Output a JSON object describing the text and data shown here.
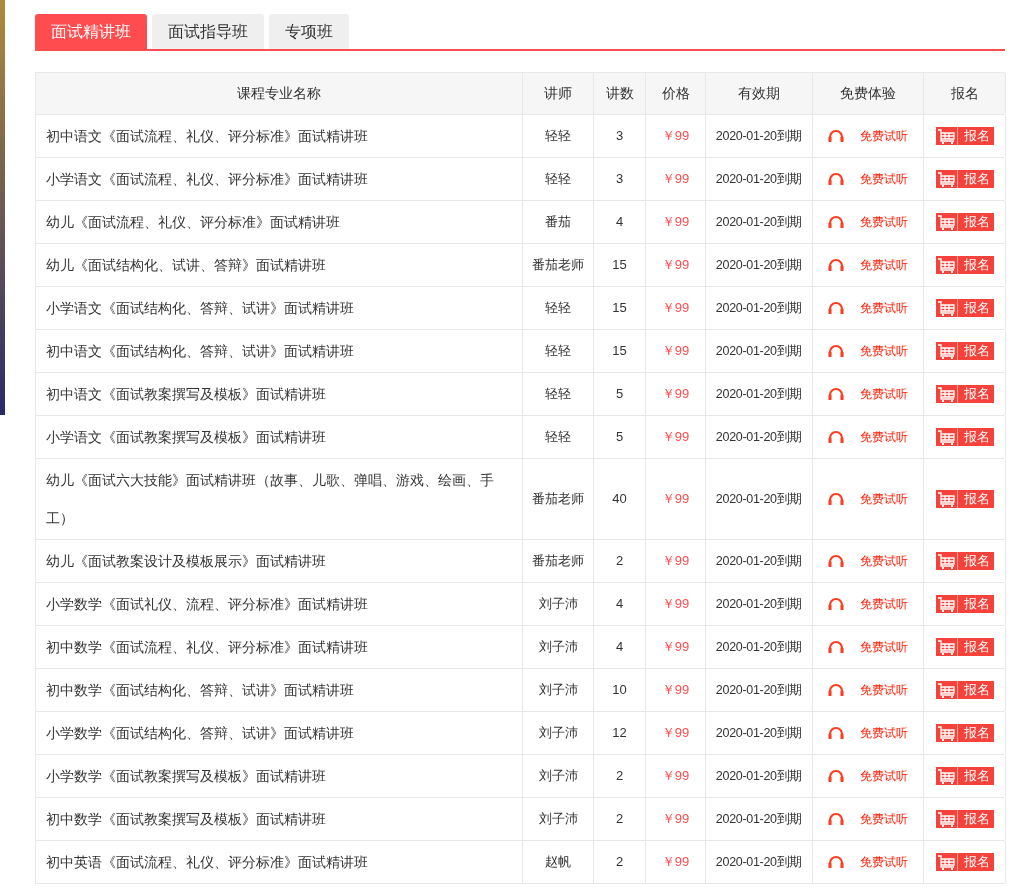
{
  "tabs": [
    {
      "label": "面试精讲班",
      "selected": true
    },
    {
      "label": "面试指导班",
      "selected": false
    },
    {
      "label": "专项班",
      "selected": false
    }
  ],
  "table": {
    "columns": [
      "课程专业名称",
      "讲师",
      "讲数",
      "价格",
      "有效期",
      "免费体验",
      "报名"
    ],
    "rows": [
      {
        "name": "初中语文《面试流程、礼仪、评分标准》面试精讲班",
        "teacher": "轻轻",
        "lessons": "3",
        "price": "￥99",
        "expiry": "2020-01-20到期",
        "trial": "免费试听",
        "signup": "报名"
      },
      {
        "name": "小学语文《面试流程、礼仪、评分标准》面试精讲班",
        "teacher": "轻轻",
        "lessons": "3",
        "price": "￥99",
        "expiry": "2020-01-20到期",
        "trial": "免费试听",
        "signup": "报名"
      },
      {
        "name": "幼儿《面试流程、礼仪、评分标准》面试精讲班",
        "teacher": "番茄",
        "lessons": "4",
        "price": "￥99",
        "expiry": "2020-01-20到期",
        "trial": "免费试听",
        "signup": "报名"
      },
      {
        "name": "幼儿《面试结构化、试讲、答辩》面试精讲班",
        "teacher": "番茄老师",
        "lessons": "15",
        "price": "￥99",
        "expiry": "2020-01-20到期",
        "trial": "免费试听",
        "signup": "报名"
      },
      {
        "name": "小学语文《面试结构化、答辩、试讲》面试精讲班",
        "teacher": "轻轻",
        "lessons": "15",
        "price": "￥99",
        "expiry": "2020-01-20到期",
        "trial": "免费试听",
        "signup": "报名"
      },
      {
        "name": "初中语文《面试结构化、答辩、试讲》面试精讲班",
        "teacher": "轻轻",
        "lessons": "15",
        "price": "￥99",
        "expiry": "2020-01-20到期",
        "trial": "免费试听",
        "signup": "报名"
      },
      {
        "name": "初中语文《面试教案撰写及模板》面试精讲班",
        "teacher": "轻轻",
        "lessons": "5",
        "price": "￥99",
        "expiry": "2020-01-20到期",
        "trial": "免费试听",
        "signup": "报名"
      },
      {
        "name": "小学语文《面试教案撰写及模板》面试精讲班",
        "teacher": "轻轻",
        "lessons": "5",
        "price": "￥99",
        "expiry": "2020-01-20到期",
        "trial": "免费试听",
        "signup": "报名"
      },
      {
        "name": "幼儿《面试六大技能》面试精讲班（故事、儿歌、弹唱、游戏、绘画、手工）",
        "teacher": "番茄老师",
        "lessons": "40",
        "price": "￥99",
        "expiry": "2020-01-20到期",
        "trial": "免费试听",
        "signup": "报名"
      },
      {
        "name": "幼儿《面试教案设计及模板展示》面试精讲班",
        "teacher": "番茄老师",
        "lessons": "2",
        "price": "￥99",
        "expiry": "2020-01-20到期",
        "trial": "免费试听",
        "signup": "报名"
      },
      {
        "name": "小学数学《面试礼仪、流程、评分标准》面试精讲班",
        "teacher": "刘子沛",
        "lessons": "4",
        "price": "￥99",
        "expiry": "2020-01-20到期",
        "trial": "免费试听",
        "signup": "报名"
      },
      {
        "name": "初中数学《面试流程、礼仪、评分标准》面试精讲班",
        "teacher": "刘子沛",
        "lessons": "4",
        "price": "￥99",
        "expiry": "2020-01-20到期",
        "trial": "免费试听",
        "signup": "报名"
      },
      {
        "name": "初中数学《面试结构化、答辩、试讲》面试精讲班",
        "teacher": "刘子沛",
        "lessons": "10",
        "price": "￥99",
        "expiry": "2020-01-20到期",
        "trial": "免费试听",
        "signup": "报名"
      },
      {
        "name": "小学数学《面试结构化、答辩、试讲》面试精讲班",
        "teacher": "刘子沛",
        "lessons": "12",
        "price": "￥99",
        "expiry": "2020-01-20到期",
        "trial": "免费试听",
        "signup": "报名"
      },
      {
        "name": "小学数学《面试教案撰写及模板》面试精讲班",
        "teacher": "刘子沛",
        "lessons": "2",
        "price": "￥99",
        "expiry": "2020-01-20到期",
        "trial": "免费试听",
        "signup": "报名"
      },
      {
        "name": "初中数学《面试教案撰写及模板》面试精讲班",
        "teacher": "刘子沛",
        "lessons": "2",
        "price": "￥99",
        "expiry": "2020-01-20到期",
        "trial": "免费试听",
        "signup": "报名"
      },
      {
        "name": "初中英语《面试流程、礼仪、评分标准》面试精讲班",
        "teacher": "赵帆",
        "lessons": "2",
        "price": "￥99",
        "expiry": "2020-01-20到期",
        "trial": "免费试听",
        "signup": "报名"
      }
    ]
  }
}
